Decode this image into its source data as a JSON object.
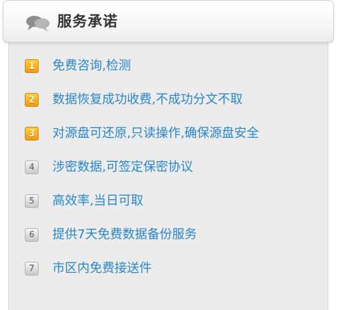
{
  "header": {
    "title": "服务承诺",
    "icon": "speech-bubbles-icon"
  },
  "colors": {
    "link": "#2a86c8",
    "badge_top": "#f39a0b",
    "badge_rest": "#c8c8c8"
  },
  "items": [
    {
      "number": "1",
      "text": "免费咨询,检测"
    },
    {
      "number": "2",
      "text": "数据恢复成功收费,不成功分文不取"
    },
    {
      "number": "3",
      "text": "对源盘可还原,只读操作,确保源盘安全"
    },
    {
      "number": "4",
      "text": "涉密数据,可签定保密协议"
    },
    {
      "number": "5",
      "text": "高效率,当日可取"
    },
    {
      "number": "6",
      "text": "提供7天免费数据备份服务"
    },
    {
      "number": "7",
      "text": "市区内免费接送件"
    }
  ]
}
